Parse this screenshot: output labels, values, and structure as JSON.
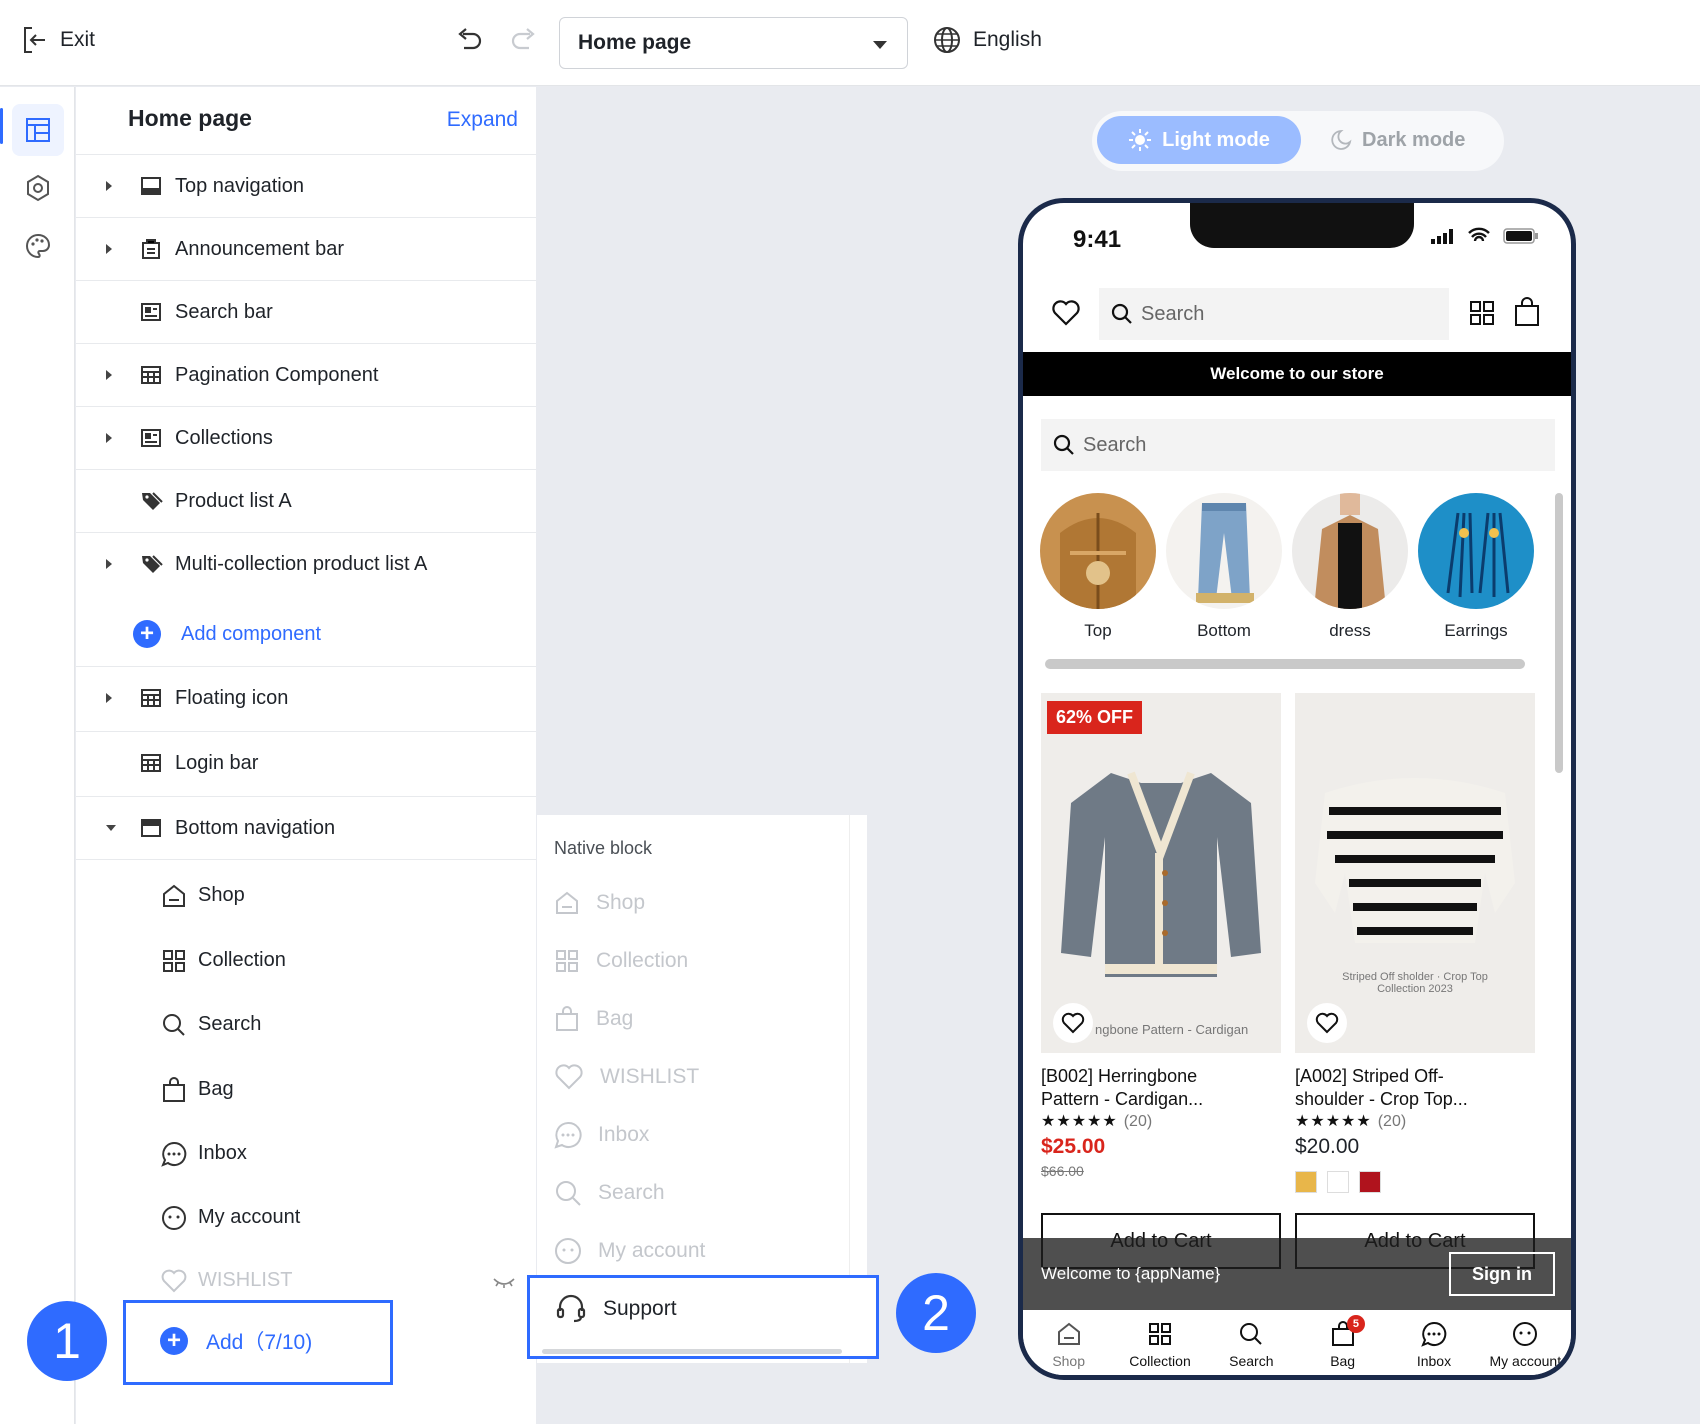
{
  "topbar": {
    "exit_label": "Exit",
    "page_select": "Home page",
    "language": "English"
  },
  "panel": {
    "title": "Home page",
    "expand_label": "Expand",
    "components": [
      {
        "label": "Top navigation",
        "icon": "layout-icon",
        "caret": "right"
      },
      {
        "label": "Announcement bar",
        "icon": "announcement-icon",
        "caret": "right"
      },
      {
        "label": "Search bar",
        "icon": "card-icon",
        "caret": ""
      },
      {
        "label": "Pagination Component",
        "icon": "grid-layout-icon",
        "caret": "right"
      },
      {
        "label": "Collections",
        "icon": "card-icon",
        "caret": "right"
      },
      {
        "label": "Product list A",
        "icon": "tag-icon",
        "caret": ""
      },
      {
        "label": "Multi-collection product list A",
        "icon": "tag-icon",
        "caret": "right"
      }
    ],
    "add_component_label": "Add component",
    "components2": [
      {
        "label": "Floating icon",
        "icon": "grid-layout-icon",
        "caret": "right"
      },
      {
        "label": "Login bar",
        "icon": "grid-layout-icon",
        "caret": ""
      },
      {
        "label": "Bottom navigation",
        "icon": "layout-icon",
        "caret": "down"
      }
    ],
    "bottom_nav_items": [
      {
        "label": "Shop",
        "icon": "home-icon"
      },
      {
        "label": "Collection",
        "icon": "grid-icon"
      },
      {
        "label": "Search",
        "icon": "search-icon"
      },
      {
        "label": "Bag",
        "icon": "bag-icon"
      },
      {
        "label": "Inbox",
        "icon": "chat-icon"
      },
      {
        "label": "My account",
        "icon": "face-icon"
      },
      {
        "label": "WISHLIST",
        "icon": "heart-icon",
        "dimmed": true
      }
    ],
    "add_button_label": "Add（7/10)",
    "step1": "1"
  },
  "popup": {
    "title": "Native block",
    "items": [
      "Shop",
      "Collection",
      "Bag",
      "WISHLIST",
      "Inbox",
      "Search",
      "My account"
    ],
    "selected": "Support",
    "step2": "2"
  },
  "preview": {
    "light_mode": "Light mode",
    "dark_mode": "Dark mode",
    "time": "9:41",
    "search_placeholder": "Search",
    "announcement": "Welcome to our store",
    "search2_placeholder": "Search",
    "categories": [
      "Top",
      "Bottom",
      "dress",
      "Earrings"
    ],
    "products": [
      {
        "discount": "62% OFF",
        "caption": "ngbone Pattern - Cardigan",
        "title_l1": "[B002] Herringbone",
        "title_l2": "Pattern - Cardigan...",
        "stars": "★★★★★",
        "reviews": "(20)",
        "price": "$25.00",
        "price_color": "#d9251c",
        "old_price": "$66.00",
        "add_to_cart": "Add to Cart"
      },
      {
        "caption_l1": "Striped Off sholder · Crop Top",
        "caption_l2": "Collection 2023",
        "title_l1": "[A002] Striped Off-",
        "title_l2": "shoulder - Crop Top...",
        "stars": "★★★★★",
        "reviews": "(20)",
        "price": "$20.00",
        "swatches": [
          "#e8b64a",
          "#ffffff",
          "#b0131d"
        ],
        "add_to_cart": "Add to Cart"
      }
    ],
    "login_text": "Welcome to {appName}",
    "sign_in": "Sign in",
    "bottom_nav": [
      "Shop",
      "Collection",
      "Search",
      "Bag",
      "Inbox",
      "My account"
    ],
    "bag_count": "5"
  }
}
